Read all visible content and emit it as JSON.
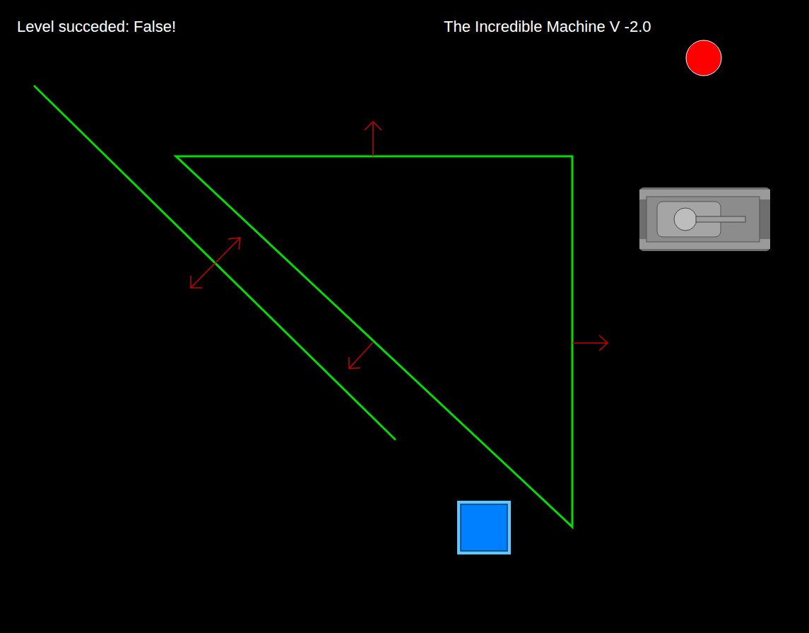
{
  "status": {
    "text": "Level succeded: False!"
  },
  "title": {
    "text": "The Incredible Machine V -2.0"
  },
  "objects": [
    {
      "kind": "ball",
      "color": "#ff0000"
    },
    {
      "kind": "tank",
      "color": "#8c8c8c"
    },
    {
      "kind": "box",
      "color": "#0080ff"
    },
    {
      "kind": "ramp",
      "color": "#00dd00"
    },
    {
      "kind": "triangle",
      "color": "#00dd00"
    }
  ],
  "arrows": [
    {
      "kind": "up",
      "color": "#cc0000"
    },
    {
      "kind": "right",
      "color": "#cc0000"
    },
    {
      "kind": "double",
      "color": "#cc0000"
    },
    {
      "kind": "diagonal",
      "color": "#cc0000"
    }
  ]
}
